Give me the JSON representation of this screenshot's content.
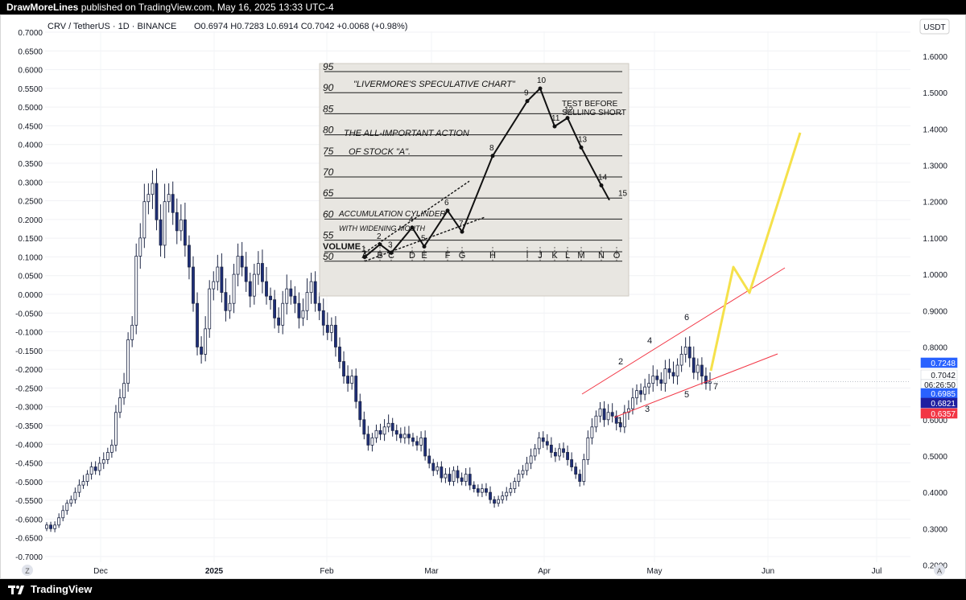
{
  "header": {
    "publisher": "DrawMoreLines",
    "published_text": "published on TradingView.com, May 16, 2025 13:33 UTC-4"
  },
  "legend": {
    "symbol": "CRV / TetherUS · 1D · BINANCE",
    "ohlc": "O0.6974 H0.7283 L0.6914 C0.7042 +0.0068 (+0.98%)"
  },
  "currency_badge": "USDT",
  "footer": {
    "logo_text": "TradingView",
    "left_button": "Z",
    "right_button": "A"
  },
  "price_tags": [
    {
      "value": "0.7248",
      "bg": "#2962ff",
      "fg": "#ffffff"
    },
    {
      "value": "0.7042",
      "bg": "#ffffff",
      "fg": "#131722"
    },
    {
      "value": "06:26:50",
      "bg": "#ffffff",
      "fg": "#131722"
    },
    {
      "value": "0.6985",
      "bg": "#2962ff",
      "fg": "#ffffff"
    },
    {
      "value": "0.6821",
      "bg": "#1e1ea0",
      "fg": "#ffffff"
    },
    {
      "value": "0.6357",
      "bg": "#f23645",
      "fg": "#ffffff"
    }
  ],
  "inset": {
    "title": "\"LIVERMORE'S SPECULATIVE CHART\"",
    "note_line1": "TEST BEFORE",
    "note_line2": "SELLING SHORT",
    "caption_line1": "THE ALL-IMPORTANT ACTION",
    "caption_line2": "OF STOCK \"A\".",
    "accum_line1": "ACCUMULATION CYLINDER",
    "accum_line2": "WITH WIDENING MOUTH",
    "volume_label": "VOLUME",
    "y_levels": [
      "95",
      "90",
      "85",
      "80",
      "75",
      "70",
      "65",
      "60",
      "55",
      "50"
    ],
    "letters": [
      "A",
      "B",
      "C",
      "D",
      "E",
      "F",
      "G",
      "H",
      "I",
      "J",
      "K",
      "L",
      "M",
      "N",
      "O"
    ],
    "point_labels": [
      "1",
      "2",
      "3",
      "4",
      "5",
      "6",
      "7",
      "8",
      "9",
      "10",
      "11",
      "12",
      "13",
      "14",
      "15"
    ],
    "path": [
      [
        1,
        51
      ],
      [
        2,
        54
      ],
      [
        3,
        52
      ],
      [
        4,
        58
      ],
      [
        5,
        53.5
      ],
      [
        6,
        62
      ],
      [
        7,
        57
      ],
      [
        8,
        75
      ],
      [
        9,
        88
      ],
      [
        10,
        91
      ],
      [
        11,
        82
      ],
      [
        12,
        84
      ],
      [
        13,
        77
      ],
      [
        14,
        68
      ]
    ]
  },
  "wave_labels": [
    "1",
    "2",
    "3",
    "4",
    "5",
    "6",
    "7"
  ],
  "chart_data": {
    "type": "candlestick",
    "symbol": "CRV / TetherUS",
    "interval": "1D",
    "exchange": "BINANCE",
    "x_ticks": [
      "Dec",
      "2025",
      "Feb",
      "Mar",
      "Apr",
      "May",
      "Jun",
      "Jul"
    ],
    "left_axis": {
      "min": -0.7,
      "max": 0.7,
      "step": 0.05
    },
    "right_axis": {
      "ticks": [
        1.6,
        1.5,
        1.4,
        1.3,
        1.2,
        1.1,
        1.0,
        0.9,
        0.8,
        0.7,
        0.6,
        0.5,
        0.4,
        0.3,
        0.2
      ]
    },
    "closes": [
      0.31,
      0.3,
      0.31,
      0.33,
      0.35,
      0.37,
      0.38,
      0.4,
      0.42,
      0.43,
      0.45,
      0.47,
      0.46,
      0.48,
      0.49,
      0.51,
      0.53,
      0.62,
      0.66,
      0.7,
      0.82,
      0.86,
      1.05,
      1.1,
      1.2,
      1.22,
      1.25,
      1.15,
      1.08,
      1.2,
      1.22,
      1.17,
      1.12,
      1.15,
      1.08,
      1.02,
      0.92,
      0.8,
      0.78,
      0.85,
      0.96,
      0.98,
      1.02,
      0.95,
      0.9,
      0.92,
      1.0,
      1.05,
      1.02,
      0.98,
      0.94,
      1.0,
      1.03,
      0.98,
      0.94,
      0.93,
      0.88,
      0.86,
      0.92,
      0.96,
      0.94,
      0.92,
      0.88,
      0.9,
      0.95,
      0.98,
      0.92,
      0.9,
      0.86,
      0.84,
      0.86,
      0.8,
      0.76,
      0.72,
      0.7,
      0.72,
      0.65,
      0.6,
      0.56,
      0.53,
      0.55,
      0.57,
      0.56,
      0.58,
      0.59,
      0.57,
      0.56,
      0.55,
      0.56,
      0.55,
      0.54,
      0.53,
      0.55,
      0.5,
      0.48,
      0.46,
      0.47,
      0.44,
      0.45,
      0.43,
      0.46,
      0.44,
      0.43,
      0.45,
      0.42,
      0.41,
      0.4,
      0.41,
      0.4,
      0.38,
      0.37,
      0.38,
      0.39,
      0.4,
      0.41,
      0.43,
      0.45,
      0.46,
      0.48,
      0.5,
      0.52,
      0.55,
      0.54,
      0.53,
      0.51,
      0.5,
      0.52,
      0.51,
      0.49,
      0.47,
      0.45,
      0.43,
      0.49,
      0.55,
      0.58,
      0.61,
      0.63,
      0.6,
      0.62,
      0.61,
      0.59,
      0.58,
      0.62,
      0.63,
      0.66,
      0.68,
      0.67,
      0.69,
      0.7,
      0.72,
      0.71,
      0.7,
      0.74,
      0.73,
      0.72,
      0.75,
      0.78,
      0.8,
      0.77,
      0.73,
      0.75,
      0.72,
      0.7,
      0.7042
    ],
    "title": "",
    "xlabel": "",
    "ylabel": ""
  }
}
